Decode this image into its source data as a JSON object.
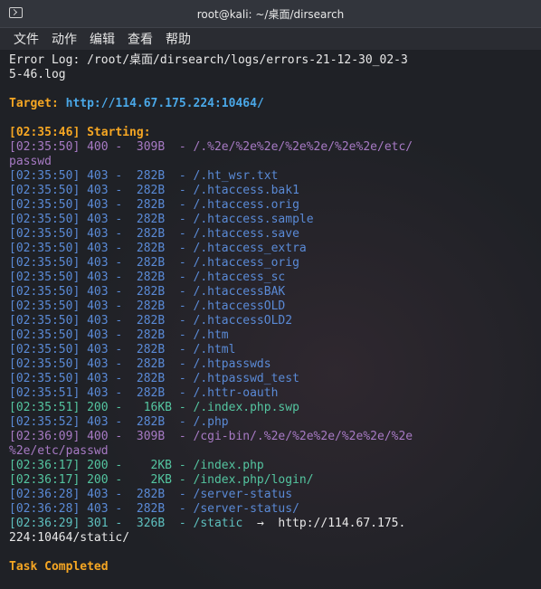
{
  "window": {
    "title": "root@kali: ~/桌面/dirsearch"
  },
  "menu": [
    "文件",
    "动作",
    "编辑",
    "查看",
    "帮助"
  ],
  "terminal": {
    "error_log": [
      "Error Log: /root/桌面/dirsearch/logs/errors-21-12-30_02-3",
      "5-46.log"
    ],
    "target_label": "Target: ",
    "target_url": "http://114.67.175.224:10464/",
    "starting": "[02:35:46] Starting:",
    "lines": [
      {
        "status": "400",
        "text": "[02:35:50] 400 -  309B  - /.%2e/%2e%2e/%2e%2e/%2e%2e/etc/"
      },
      {
        "status": "400",
        "text": "passwd"
      },
      {
        "status": "403",
        "text": "[02:35:50] 403 -  282B  - /.ht_wsr.txt"
      },
      {
        "status": "403",
        "text": "[02:35:50] 403 -  282B  - /.htaccess.bak1"
      },
      {
        "status": "403",
        "text": "[02:35:50] 403 -  282B  - /.htaccess.orig"
      },
      {
        "status": "403",
        "text": "[02:35:50] 403 -  282B  - /.htaccess.sample"
      },
      {
        "status": "403",
        "text": "[02:35:50] 403 -  282B  - /.htaccess.save"
      },
      {
        "status": "403",
        "text": "[02:35:50] 403 -  282B  - /.htaccess_extra"
      },
      {
        "status": "403",
        "text": "[02:35:50] 403 -  282B  - /.htaccess_orig"
      },
      {
        "status": "403",
        "text": "[02:35:50] 403 -  282B  - /.htaccess_sc"
      },
      {
        "status": "403",
        "text": "[02:35:50] 403 -  282B  - /.htaccessBAK"
      },
      {
        "status": "403",
        "text": "[02:35:50] 403 -  282B  - /.htaccessOLD"
      },
      {
        "status": "403",
        "text": "[02:35:50] 403 -  282B  - /.htaccessOLD2"
      },
      {
        "status": "403",
        "text": "[02:35:50] 403 -  282B  - /.htm"
      },
      {
        "status": "403",
        "text": "[02:35:50] 403 -  282B  - /.html"
      },
      {
        "status": "403",
        "text": "[02:35:50] 403 -  282B  - /.htpasswds"
      },
      {
        "status": "403",
        "text": "[02:35:50] 403 -  282B  - /.htpasswd_test"
      },
      {
        "status": "403",
        "text": "[02:35:51] 403 -  282B  - /.httr-oauth"
      },
      {
        "status": "200",
        "text": "[02:35:51] 200 -   16KB - /.index.php.swp"
      },
      {
        "status": "403",
        "text": "[02:35:52] 403 -  282B  - /.php"
      },
      {
        "status": "400",
        "text": "[02:36:09] 400 -  309B  - /cgi-bin/.%2e/%2e%2e/%2e%2e/%2e"
      },
      {
        "status": "400",
        "text": "%2e/etc/passwd"
      },
      {
        "status": "200",
        "text": "[02:36:17] 200 -    2KB - /index.php"
      },
      {
        "status": "200",
        "text": "[02:36:17] 200 -    2KB - /index.php/login/"
      },
      {
        "status": "403",
        "text": "[02:36:28] 403 -  282B  - /server-status"
      },
      {
        "status": "403",
        "text": "[02:36:28] 403 -  282B  - /server-status/"
      }
    ],
    "redirect_line": {
      "prefix": "[02:36:29] 301 -  326B  - /static  ",
      "arrow": "→",
      "target": "  http://114.67.175.",
      "wrap": "224:10464/static/"
    },
    "completed": "Task Completed"
  },
  "colors": {
    "status_400": "#a77ac4",
    "status_403": "#5a8ad6",
    "status_200": "#54c5a0",
    "status_301": "#5ec0bf",
    "heading": "#f5a623",
    "url": "#4aa8e8"
  }
}
